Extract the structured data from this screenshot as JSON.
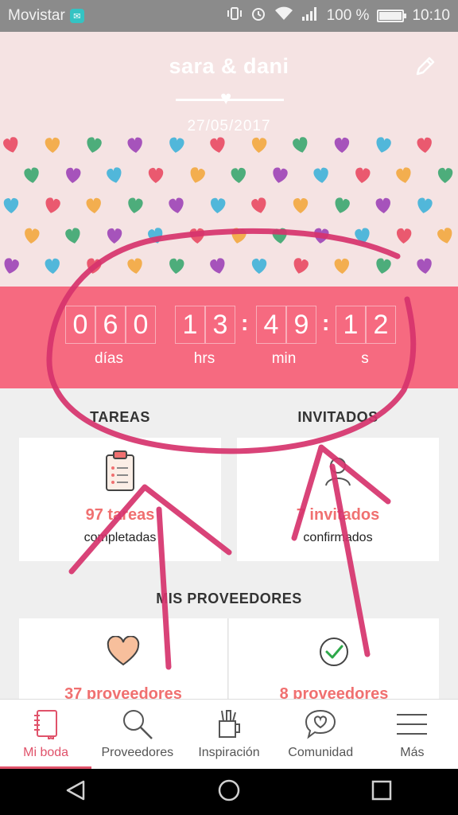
{
  "status_bar": {
    "carrier": "Movistar",
    "battery": "100 %",
    "battery_level": 1.0,
    "time": "10:10"
  },
  "header": {
    "couple": "sara & dani",
    "date": "27/05/2017"
  },
  "countdown": {
    "days_digits": [
      "0",
      "6",
      "0"
    ],
    "hours_digits": [
      "1",
      "3"
    ],
    "minutes_digits": [
      "4",
      "9"
    ],
    "seconds_digits": [
      "1",
      "2"
    ],
    "units": {
      "days": "días",
      "hours": "hrs",
      "minutes": "min",
      "seconds": "s"
    },
    "separator": ":"
  },
  "tasks": {
    "title": "TAREAS",
    "count": "97 tareas",
    "subtitle": "completadas"
  },
  "guests": {
    "title": "INVITADOS",
    "count": "7 invitados",
    "subtitle": "confirmados"
  },
  "vendors": {
    "title": "MIS PROVEEDORES",
    "left_count": "37 proveedores",
    "right_count": "8 proveedores"
  },
  "bottom_nav": [
    {
      "label": "Mi boda",
      "icon": "notebook-icon",
      "active": true
    },
    {
      "label": "Proveedores",
      "icon": "magnifier-icon",
      "active": false
    },
    {
      "label": "Inspiración",
      "icon": "brush-cup-icon",
      "active": false
    },
    {
      "label": "Comunidad",
      "icon": "chat-heart-icon",
      "active": false
    },
    {
      "label": "Más",
      "icon": "menu-icon",
      "active": false
    }
  ],
  "colors": {
    "accent": "#e0526a",
    "countdown_bg": "#f66a80",
    "header_bg": "#f5e3e3",
    "annotation": "#d6336c"
  },
  "heart_colors": [
    "#e8465f",
    "#9b3fb5",
    "#f2a63a",
    "#3ab0d8",
    "#35a56c"
  ]
}
